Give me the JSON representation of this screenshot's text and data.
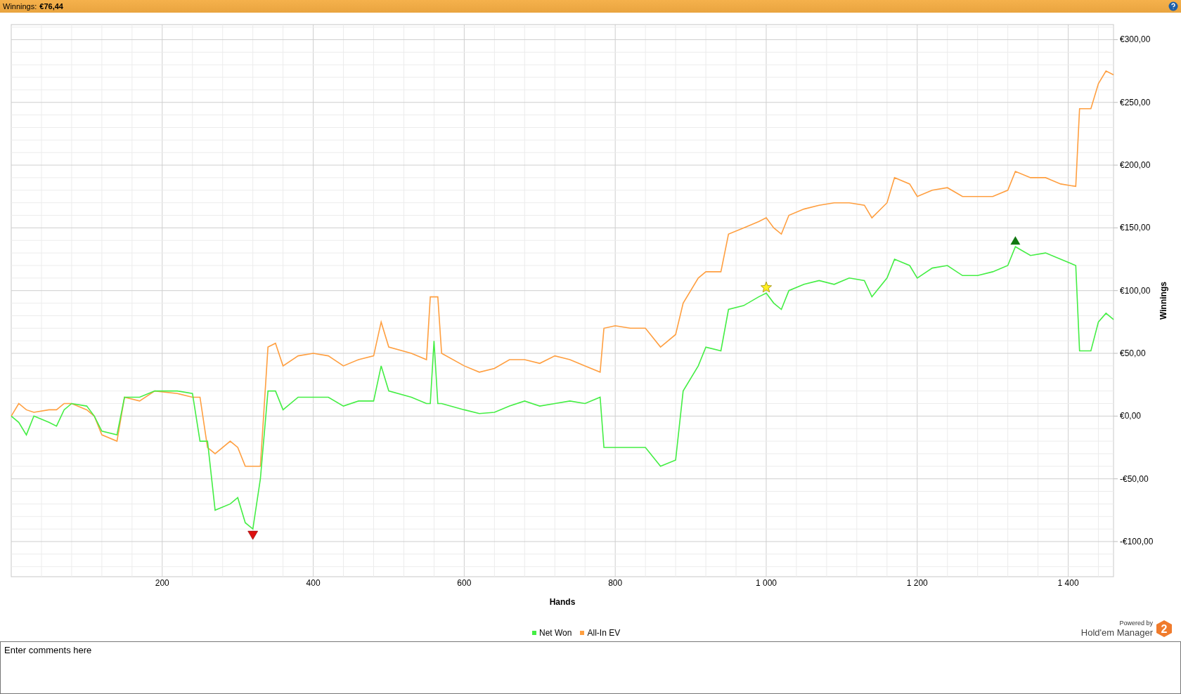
{
  "header": {
    "label": "Winnings:",
    "value": "€76,44"
  },
  "chart": {
    "chart_data": {
      "type": "line",
      "xlabel": "Hands",
      "ylabel": "Winnings",
      "xlim": [
        0,
        1460
      ],
      "ylim": [
        -128,
        312
      ],
      "xticks": [
        {
          "value": 200,
          "label": "200"
        },
        {
          "value": 400,
          "label": "400"
        },
        {
          "value": 600,
          "label": "600"
        },
        {
          "value": 800,
          "label": "800"
        },
        {
          "value": 1000,
          "label": "1 000"
        },
        {
          "value": 1200,
          "label": "1 200"
        },
        {
          "value": 1400,
          "label": "1 400"
        }
      ],
      "yticks": [
        {
          "value": 300,
          "label": "€300,00"
        },
        {
          "value": 250,
          "label": "€250,00"
        },
        {
          "value": 200,
          "label": "€200,00"
        },
        {
          "value": 150,
          "label": "€150,00"
        },
        {
          "value": 100,
          "label": "€100,00"
        },
        {
          "value": 50,
          "label": "€50,00"
        },
        {
          "value": 0,
          "label": "€0,00"
        },
        {
          "value": -50,
          "label": "-€50,00"
        },
        {
          "value": -100,
          "label": "-€100,00"
        }
      ],
      "x": [
        0,
        10,
        20,
        30,
        50,
        60,
        70,
        80,
        100,
        110,
        120,
        140,
        150,
        170,
        190,
        220,
        240,
        250,
        260,
        270,
        290,
        300,
        310,
        320,
        330,
        340,
        350,
        360,
        380,
        400,
        420,
        440,
        460,
        480,
        490,
        500,
        530,
        550,
        555,
        560,
        565,
        570,
        600,
        620,
        640,
        660,
        680,
        700,
        720,
        740,
        760,
        780,
        785,
        800,
        820,
        840,
        860,
        880,
        890,
        910,
        920,
        940,
        950,
        970,
        990,
        1000,
        1010,
        1020,
        1030,
        1050,
        1070,
        1090,
        1110,
        1130,
        1140,
        1160,
        1170,
        1190,
        1200,
        1220,
        1240,
        1260,
        1280,
        1300,
        1320,
        1330,
        1350,
        1370,
        1390,
        1410,
        1415,
        1430,
        1440,
        1450,
        1460
      ],
      "series": [
        {
          "name": "Net Won",
          "color": "#44ee44",
          "values": [
            0,
            -5,
            -15,
            0,
            -5,
            -8,
            5,
            10,
            8,
            0,
            -12,
            -15,
            15,
            15,
            20,
            20,
            18,
            -20,
            -20,
            -75,
            -70,
            -65,
            -85,
            -90,
            -50,
            20,
            20,
            5,
            15,
            15,
            15,
            8,
            12,
            12,
            40,
            20,
            15,
            10,
            10,
            60,
            10,
            10,
            5,
            2,
            3,
            8,
            12,
            8,
            10,
            12,
            10,
            15,
            -25,
            -25,
            -25,
            -25,
            -40,
            -35,
            20,
            40,
            55,
            52,
            85,
            88,
            95,
            98,
            90,
            85,
            100,
            105,
            108,
            105,
            110,
            108,
            95,
            110,
            125,
            120,
            110,
            118,
            120,
            112,
            112,
            115,
            120,
            135,
            128,
            130,
            125,
            120,
            52,
            52,
            75,
            82,
            77
          ]
        },
        {
          "name": "All-In EV",
          "color": "#ff9f40",
          "values": [
            0,
            10,
            5,
            3,
            5,
            5,
            10,
            10,
            5,
            0,
            -15,
            -20,
            15,
            12,
            20,
            18,
            15,
            15,
            -25,
            -30,
            -20,
            -25,
            -40,
            -40,
            -40,
            55,
            58,
            40,
            48,
            50,
            48,
            40,
            45,
            48,
            75,
            55,
            50,
            45,
            95,
            95,
            95,
            50,
            40,
            35,
            38,
            45,
            45,
            42,
            48,
            45,
            40,
            35,
            70,
            72,
            70,
            70,
            55,
            65,
            90,
            110,
            115,
            115,
            145,
            150,
            155,
            158,
            150,
            145,
            160,
            165,
            168,
            170,
            170,
            168,
            158,
            170,
            190,
            185,
            175,
            180,
            182,
            175,
            175,
            175,
            180,
            195,
            190,
            190,
            185,
            183,
            245,
            245,
            265,
            275,
            272
          ]
        }
      ],
      "grid": true
    },
    "markers": [
      {
        "kind": "low"
      },
      {
        "kind": "high"
      },
      {
        "kind": "star"
      }
    ]
  },
  "branding": {
    "caption": "Powered by",
    "product": "Hold'em Manager",
    "badge": "2"
  },
  "comments": {
    "placeholder": "Enter comments here"
  }
}
